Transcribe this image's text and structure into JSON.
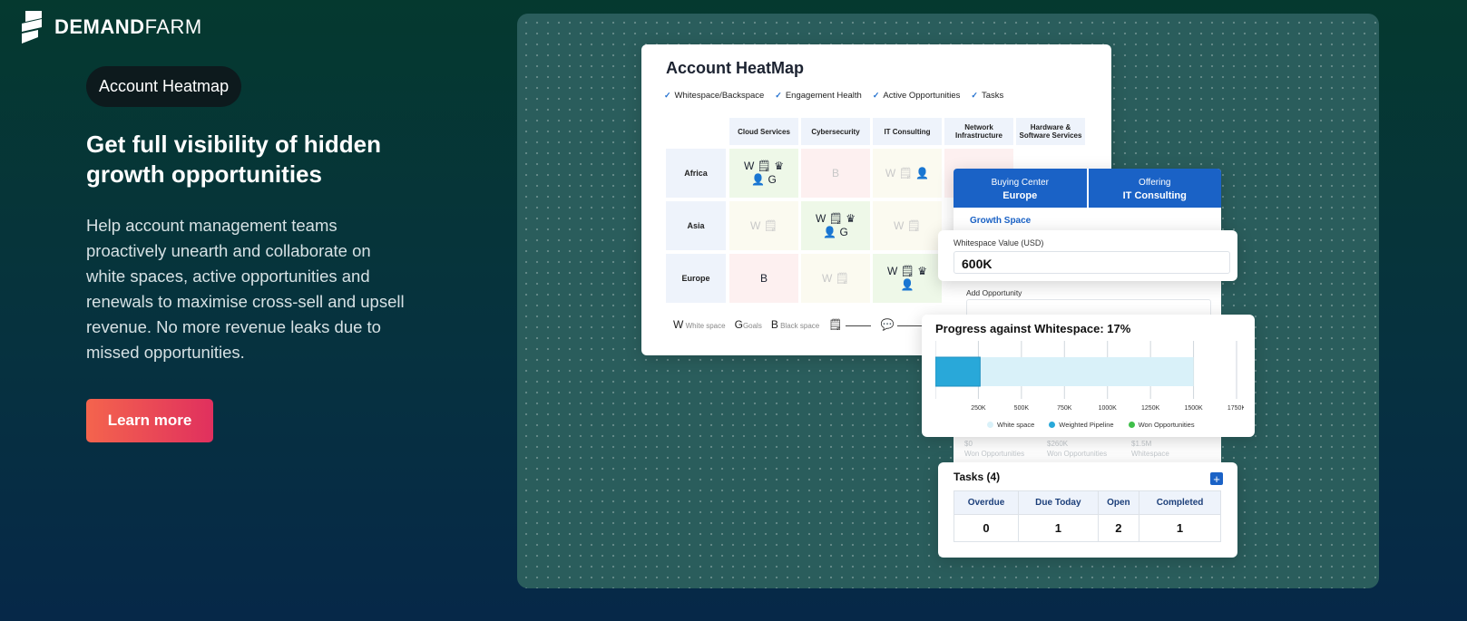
{
  "brand": {
    "name_bold": "DEMAND",
    "name_light": "FARM"
  },
  "hero": {
    "pill": "Account Heatmap",
    "headline": "Get full visibility of hidden growth opportunities",
    "description": "Help account management teams proactively unearth and collaborate on white spaces, active opportunities and renewals to maximise cross-sell and upsell revenue. No more revenue leaks due to missed opportunities.",
    "cta": "Learn more"
  },
  "heatmap": {
    "title": "Account HeatMap",
    "filters": [
      "Whitespace/Backspace",
      "Engagement Health",
      "Active Opportunities",
      "Tasks"
    ],
    "columns": [
      "Cloud Services",
      "Cybersecurity",
      "IT Consulting",
      "Network Infrastructure",
      "Hardware & Software Services"
    ],
    "rows": [
      "Africa",
      "Asia",
      "Europe"
    ],
    "cells": {
      "africa_cloud": "W 🗒 ♛",
      "africa_cloud_2": "👤 G",
      "africa_cyber": "B",
      "africa_it": "W 🗒 👤",
      "asia_cloud": "W 🗒",
      "asia_cyber": "W 🗒 ♛",
      "asia_cyber_2": "👤 G",
      "asia_it": "W 🗒",
      "europe_cloud": "B",
      "europe_cyber": "W 🗒",
      "europe_it": "W 🗒 ♛",
      "europe_it_2": "👤"
    },
    "legend": {
      "w_letter": "W",
      "w_label": "White space",
      "g_letter": "G",
      "g_label": "Goals",
      "b_letter": "B",
      "b_label": "Black space"
    }
  },
  "buying_center": {
    "tab1_label": "Buying Center",
    "tab1_value": "Europe",
    "tab2_label": "Offering",
    "tab2_value": "IT Consulting",
    "growth_label": "Growth Space"
  },
  "whitespace": {
    "label": "Whitespace Value (USD)",
    "value": "600K"
  },
  "add_opportunity": {
    "label": "Add Opportunity"
  },
  "progress": {
    "title": "Progress against Whitespace: 17%",
    "legend": [
      "White space",
      "Weighted Pipeline",
      "Won Opportunities"
    ],
    "colors": {
      "white_space": "#d9f1f9",
      "weighted": "#29a8d9",
      "won": "#3fbf4a"
    }
  },
  "chart_data": {
    "type": "bar",
    "orientation": "horizontal",
    "title": "Progress against Whitespace: 17%",
    "x_ticks": [
      "250K",
      "500K",
      "750K",
      "1000K",
      "1250K",
      "1500K",
      "1750K"
    ],
    "xlim": [
      0,
      1750000
    ],
    "series": [
      {
        "name": "White space",
        "values": [
          1500000
        ]
      },
      {
        "name": "Weighted Pipeline",
        "values": [
          260000
        ]
      },
      {
        "name": "Won Opportunities",
        "values": [
          0
        ]
      }
    ]
  },
  "stats": [
    {
      "value": "$0",
      "label": "Won Opportunities"
    },
    {
      "value": "$260K",
      "label": "Won Opportunities"
    },
    {
      "value": "$1.5M",
      "label": "Whitespace"
    }
  ],
  "tasks": {
    "title": "Tasks (4)",
    "add": "+",
    "headers": [
      "Overdue",
      "Due Today",
      "Open",
      "Completed"
    ],
    "values": [
      "0",
      "1",
      "2",
      "1"
    ]
  }
}
